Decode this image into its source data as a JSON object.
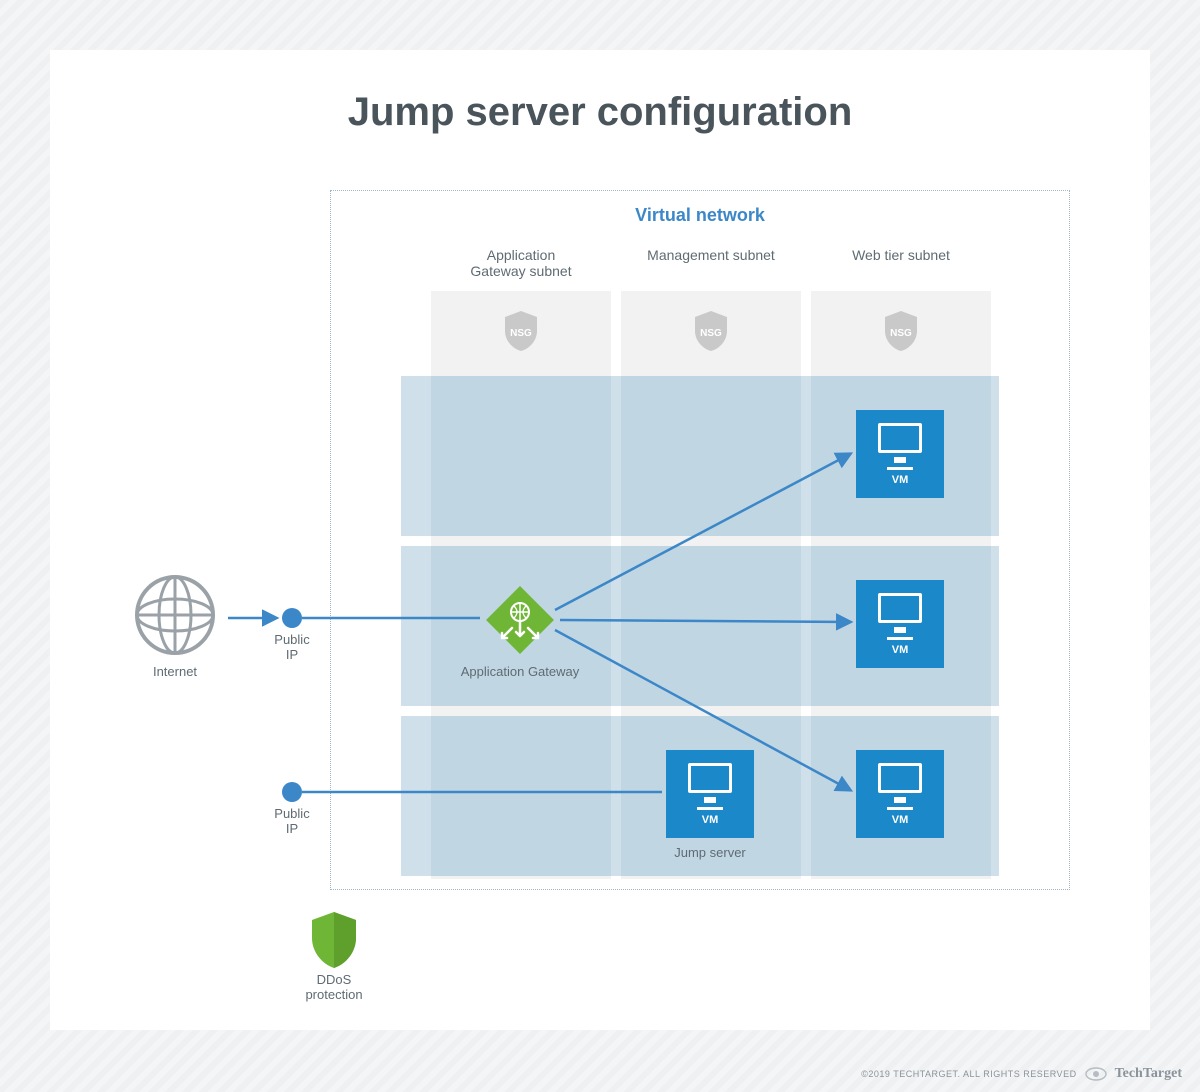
{
  "title": "Jump server configuration",
  "vnet_label": "Virtual network",
  "columns": {
    "app_gateway_subnet": "Application\nGateway subnet",
    "management_subnet": "Management subnet",
    "web_tier_subnet": "Web tier subnet"
  },
  "nsg_label": "NSG",
  "nodes": {
    "internet": "Internet",
    "public_ip_1": "Public\nIP",
    "public_ip_2": "Public\nIP",
    "app_gateway": "Application Gateway",
    "jump_server": "Jump server",
    "vm": "VM",
    "ddos": "DDoS\nprotection"
  },
  "footer": {
    "copyright": "©2019 TECHTARGET. ALL RIGHTS RESERVED",
    "brand": "TechTarget"
  },
  "colors": {
    "accent_blue": "#3b87c8",
    "azure_blue": "#1a88c9",
    "green": "#6fb536",
    "light_blue": "#cfe0ea"
  }
}
